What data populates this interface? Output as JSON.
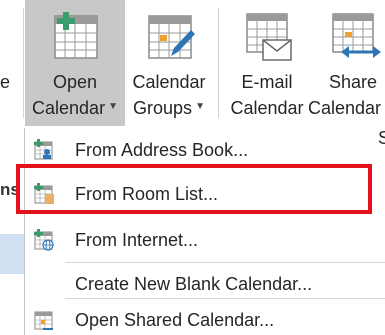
{
  "ribbon": {
    "cut_left": {
      "line1": "e",
      "line2": ""
    },
    "open_calendar": {
      "line1": "Open",
      "line2": "Calendar"
    },
    "calendar_groups": {
      "line1": "Calendar",
      "line2": "Groups"
    },
    "email_calendar": {
      "line1": "E-mail",
      "line2": "Calendar"
    },
    "share_calendar": {
      "line1": "Share",
      "line2": "Calendar"
    }
  },
  "sidebar": {
    "cut_label": "ns"
  },
  "menu": {
    "items": [
      {
        "label": "From Address Book...",
        "icon": "address-book-icon"
      },
      {
        "label": "From Room List...",
        "icon": "room-list-icon"
      },
      {
        "label": "From Internet...",
        "icon": "internet-calendar-icon"
      },
      {
        "label": "Create New Blank Calendar...",
        "icon": ""
      },
      {
        "label": "Open Shared Calendar...",
        "icon": "shared-calendar-icon"
      }
    ],
    "right_cut": "S"
  },
  "colors": {
    "selected_button": "#c8c8c8",
    "highlight_border": "#e3121d",
    "accent_green": "#3a9d6e",
    "accent_blue": "#2e75b6",
    "accent_orange": "#f0a030"
  }
}
